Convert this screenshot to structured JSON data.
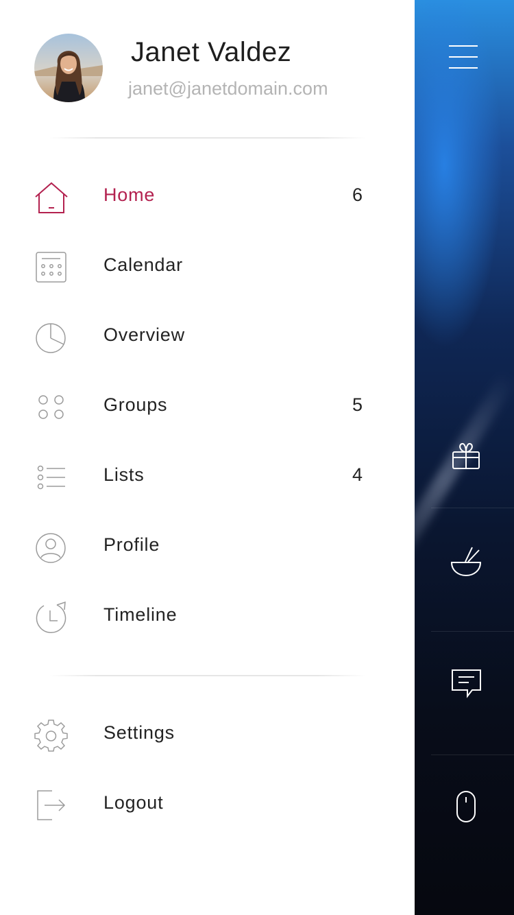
{
  "user": {
    "name": "Janet Valdez",
    "email": "janet@janetdomain.com"
  },
  "menu": {
    "items": [
      {
        "label": "Home",
        "count": "6",
        "icon": "home-icon",
        "active": true
      },
      {
        "label": "Calendar",
        "count": "",
        "icon": "calendar-icon"
      },
      {
        "label": "Overview",
        "count": "",
        "icon": "pie-chart-icon"
      },
      {
        "label": "Groups",
        "count": "5",
        "icon": "groups-icon"
      },
      {
        "label": "Lists",
        "count": "4",
        "icon": "list-icon"
      },
      {
        "label": "Profile",
        "count": "",
        "icon": "user-icon"
      },
      {
        "label": "Timeline",
        "count": "",
        "icon": "timeline-icon"
      }
    ],
    "footer_items": [
      {
        "label": "Settings",
        "icon": "gear-icon"
      },
      {
        "label": "Logout",
        "icon": "logout-icon"
      }
    ]
  },
  "side_panel": {
    "icons": [
      "menu-icon",
      "gift-icon",
      "bowl-icon",
      "chat-icon",
      "mouse-icon"
    ]
  },
  "colors": {
    "accent": "#b3214f",
    "text": "#232323",
    "muted": "#b4b4b4",
    "icon_stroke": "#9b9b9b"
  }
}
